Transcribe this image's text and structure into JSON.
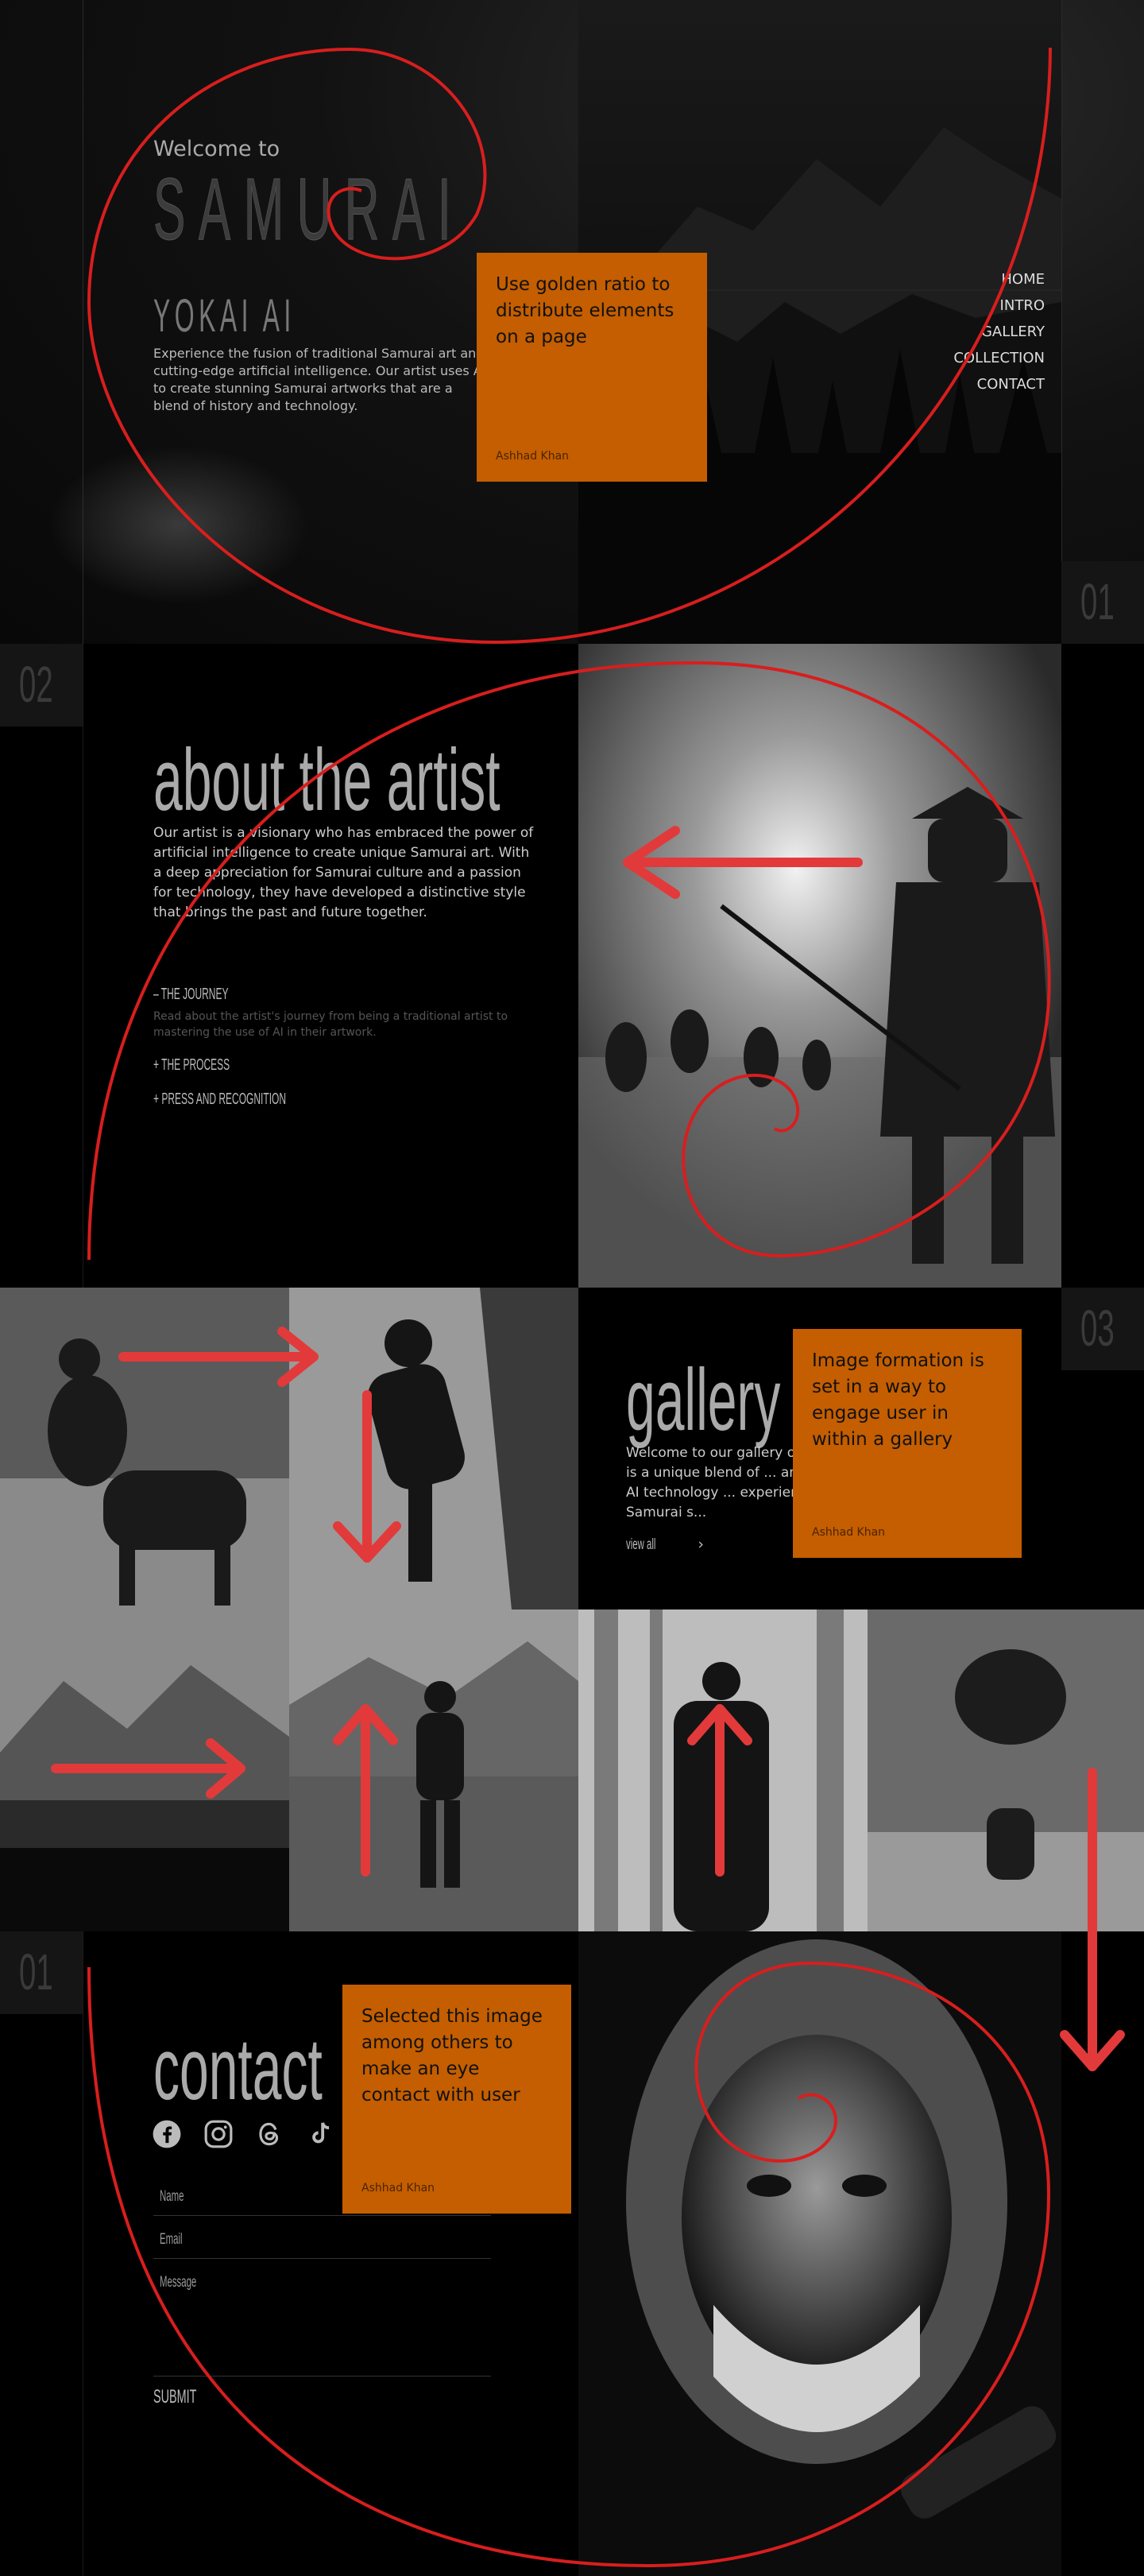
{
  "hero": {
    "welcome": "Welcome to",
    "title": "SAMURAI",
    "subtitle": "YOKAI AI",
    "description": "Experience the fusion of traditional Samurai art and cutting-edge artificial intelligence. Our artist uses AI to create stunning Samurai artworks that are a blend of history and technology.",
    "section_number": "01"
  },
  "nav": [
    "HOME",
    "INTRO",
    "GALLERY",
    "COLLECTION",
    "CONTACT"
  ],
  "notes": [
    {
      "text": "Use golden ratio to distribute elements on a page",
      "author": "Ashhad Khan"
    },
    {
      "text": "Image formation is set in a way to engage user in within a gallery",
      "author": "Ashhad Khan"
    },
    {
      "text": "Selected this image among others to make an eye contact with user",
      "author": "Ashhad Khan"
    }
  ],
  "about": {
    "section_number": "02",
    "title": "about the artist",
    "description": "Our artist is a visionary who has embraced the power of artificial intelligence to create unique Samurai art. With a deep appreciation for Samurai culture and a passion for technology, they have developed a distinctive style that brings the past and future together.",
    "accordion": [
      {
        "title": "– THE JOURNEY",
        "body": "Read about the artist's journey from being a traditional artist to mastering the use of AI in their artwork."
      },
      {
        "title": "+ THE PROCESS",
        "body": ""
      },
      {
        "title": "+ PRESS AND RECOGNITION",
        "body": ""
      }
    ]
  },
  "gallery": {
    "section_number": "03",
    "title": "gallery",
    "description": "Welcome to our gallery of ... piece is a unique blend of ... and modern AI technology ... experience the Samurai s...",
    "view_all": "view all"
  },
  "contact": {
    "section_number": "01",
    "title": "contact",
    "fields": {
      "name": "Name",
      "email": "Email",
      "message": "Message"
    },
    "submit": "SUBMIT",
    "social_icons": [
      "facebook-icon",
      "instagram-icon",
      "threads-icon",
      "tiktok-icon"
    ]
  },
  "colors": {
    "accent_orange": "#c45e00",
    "annotation_red": "#e02828",
    "background": "#000000"
  }
}
